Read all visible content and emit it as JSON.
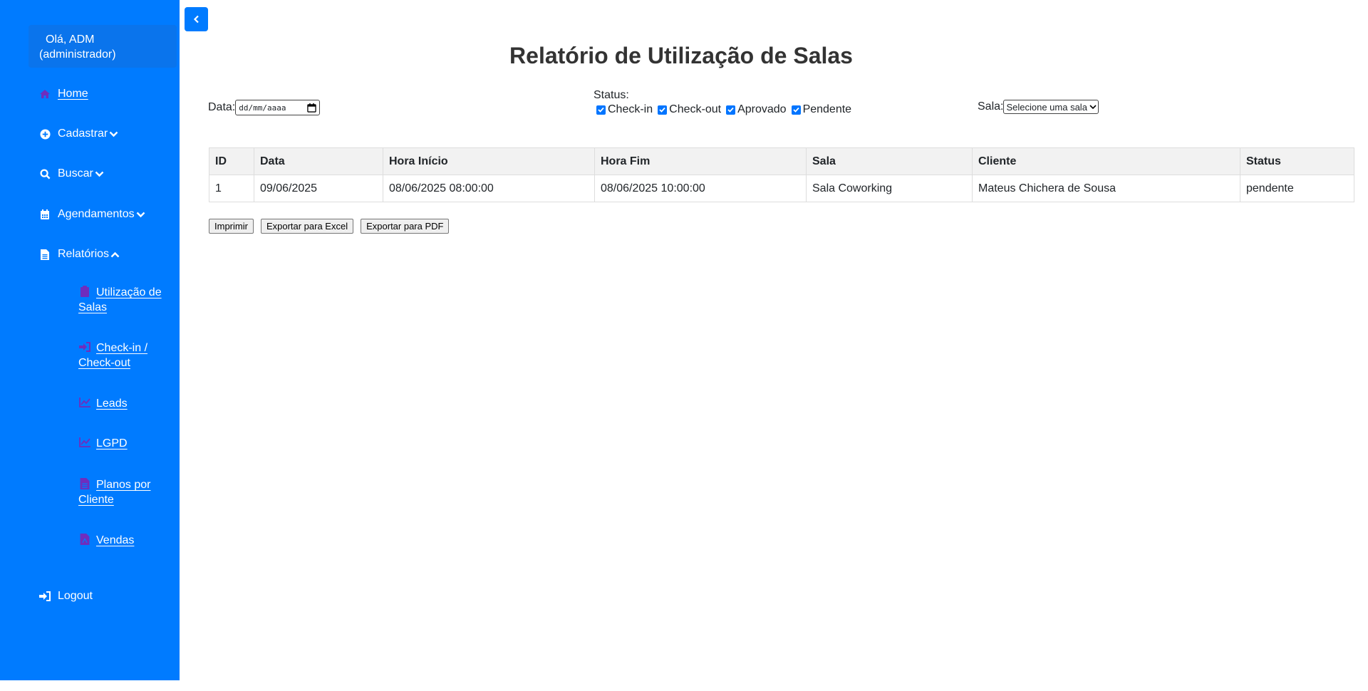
{
  "sidebar": {
    "greeting_line1": "Olá, ADM",
    "greeting_line2": "(administrador)",
    "items": [
      {
        "label": "Home",
        "icon": "home-icon"
      },
      {
        "label": "Cadastrar",
        "icon": "plus-circle-icon"
      },
      {
        "label": "Buscar",
        "icon": "search-icon"
      },
      {
        "label": "Agendamentos",
        "icon": "calendar-icon"
      },
      {
        "label": "Relatórios",
        "icon": "file-icon"
      }
    ],
    "subitems": [
      {
        "label": "Utilização de Salas",
        "icon": "clipboard-icon"
      },
      {
        "label": "Check-in / Check-out",
        "icon": "sign-in-icon"
      },
      {
        "label": "Leads",
        "icon": "chart-line-icon"
      },
      {
        "label": "LGPD",
        "icon": "chart-line-icon"
      },
      {
        "label": "Planos por Cliente",
        "icon": "file-icon"
      },
      {
        "label": "Vendas",
        "icon": "file-pdf-icon"
      }
    ],
    "logout": "Logout",
    "bg_color": "#007bff",
    "subicon_color": "#6f2dbd"
  },
  "page": {
    "title": "Relatório de Utilização de Salas"
  },
  "filters": {
    "data_label": "Data:",
    "date_placeholder": "dd/mm/aaaa",
    "status_label": "Status:",
    "status_options": [
      {
        "label": "Check-in",
        "checked": true
      },
      {
        "label": "Check-out",
        "checked": true
      },
      {
        "label": "Aprovado",
        "checked": true
      },
      {
        "label": "Pendente",
        "checked": true
      }
    ],
    "sala_label": "Sala:",
    "sala_selected": "Selecione uma sala"
  },
  "table": {
    "headers": [
      "ID",
      "Data",
      "Hora Início",
      "Hora Fim",
      "Sala",
      "Cliente",
      "Status"
    ],
    "rows": [
      [
        "1",
        "09/06/2025",
        "08/06/2025 08:00:00",
        "08/06/2025 10:00:00",
        "Sala Coworking",
        "Mateus Chichera de Sousa",
        "pendente"
      ]
    ]
  },
  "actions": {
    "print": "Imprimir",
    "excel": "Exportar para Excel",
    "pdf": "Exportar para PDF"
  }
}
